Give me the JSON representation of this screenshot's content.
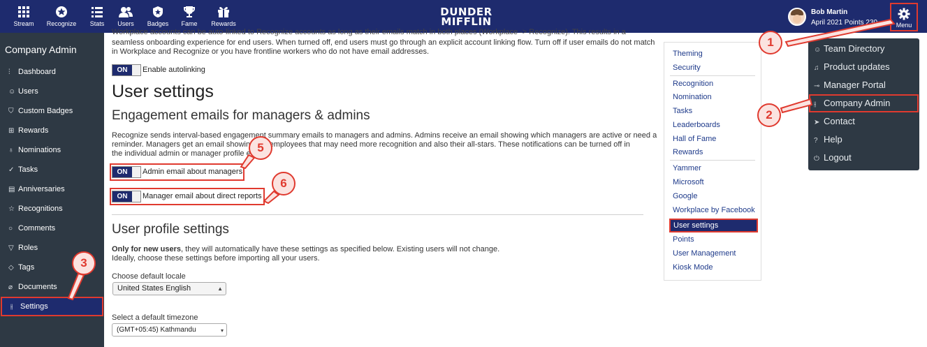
{
  "topnav": {
    "items": [
      {
        "label": "Stream",
        "icon": "grid-icon"
      },
      {
        "label": "Recognize",
        "icon": "star-badge-icon"
      },
      {
        "label": "Stats",
        "icon": "list-icon"
      },
      {
        "label": "Users",
        "icon": "users-icon"
      },
      {
        "label": "Badges",
        "icon": "shield-icon"
      },
      {
        "label": "Fame",
        "icon": "trophy-icon"
      },
      {
        "label": "Rewards",
        "icon": "gift-icon"
      }
    ],
    "brand_line1": "DUNDER",
    "brand_line2": "MIFFLIN",
    "user_name": "Bob Martin",
    "user_points": "April 2021 Points 230",
    "menu_label": "Menu"
  },
  "sidebar": {
    "title": "Company Admin",
    "items": [
      {
        "label": "Dashboard",
        "icon": "bar-chart-icon"
      },
      {
        "label": "Users",
        "icon": "user-icon"
      },
      {
        "label": "Custom Badges",
        "icon": "shield-icon"
      },
      {
        "label": "Rewards",
        "icon": "gift-icon"
      },
      {
        "label": "Nominations",
        "icon": "award-icon"
      },
      {
        "label": "Tasks",
        "icon": "check-circle-icon"
      },
      {
        "label": "Anniversaries",
        "icon": "calendar-icon"
      },
      {
        "label": "Recognitions",
        "icon": "star-icon"
      },
      {
        "label": "Comments",
        "icon": "comment-icon"
      },
      {
        "label": "Roles",
        "icon": "filter-icon"
      },
      {
        "label": "Tags",
        "icon": "tag-icon"
      },
      {
        "label": "Documents",
        "icon": "paperclip-icon"
      },
      {
        "label": "Settings",
        "icon": "sliders-icon"
      }
    ]
  },
  "main": {
    "intro_line1": "Workplace accounts can be auto-linked to Recognize accounts as long as their emails match in both places (Workplace -> Recognize). This results in a more",
    "intro_line2": "seamless onboarding experience for end users. When turned off, end users must go through an explicit account linking flow. Turn off if user emails do not match",
    "intro_line3": "in Workplace and Recognize or you have frontline workers who do not have email addresses.",
    "autolink_toggle": "ON",
    "autolink_label": "Enable autolinking",
    "user_settings_heading": "User settings",
    "engagement_heading": "Engagement emails for managers & admins",
    "engagement_p1": "Recognize sends interval-based engagement summary emails to managers and admins. Admins receive an email showing which managers are active or need a",
    "engagement_p2": "reminder. Managers get an email showing the employees that may need more recognition and also their all-stars. These notifications can be turned off in",
    "engagement_p3": "the individual admin or manager profile edit.",
    "admin_toggle": "ON",
    "admin_label": "Admin email about managers",
    "manager_toggle": "ON",
    "manager_label": "Manager email about direct reports",
    "profile_heading": "User profile settings",
    "profile_bold": "Only for new users",
    "profile_rest": ", they will automatically have these settings as specified below. Existing users will not change.",
    "profile_line2": "Ideally, choose these settings before importing all your users.",
    "locale_label": "Choose default locale",
    "locale_value": "United States English",
    "timezone_label": "Select a default timezone",
    "timezone_value": "(GMT+05:45) Kathmandu"
  },
  "rightnav": {
    "group1": [
      "Theming",
      "Security"
    ],
    "group2": [
      "Recognition",
      "Nomination",
      "Tasks",
      "Leaderboards",
      "Hall of Fame",
      "Rewards"
    ],
    "group3": [
      "Yammer",
      "Microsoft",
      "Google",
      "Workplace by Facebook"
    ],
    "active": "User settings",
    "group4": [
      "Points",
      "User Management",
      "Kiosk Mode"
    ]
  },
  "dropdown": {
    "items": [
      {
        "label": "Team Directory",
        "icon": "users-icon"
      },
      {
        "label": "Product updates",
        "icon": "bell-icon"
      },
      {
        "label": "Manager Portal",
        "icon": "key-icon"
      },
      {
        "label": "Company Admin",
        "icon": "sliders-icon"
      },
      {
        "label": "Contact",
        "icon": "send-icon"
      },
      {
        "label": "Help",
        "icon": "help-icon"
      },
      {
        "label": "Logout",
        "icon": "power-icon"
      }
    ]
  },
  "callouts": [
    "1",
    "2",
    "3",
    "5",
    "6"
  ],
  "colors": {
    "navy": "#1e2b6e",
    "sidebar": "#2e3944",
    "highlight": "#e03a2f"
  }
}
